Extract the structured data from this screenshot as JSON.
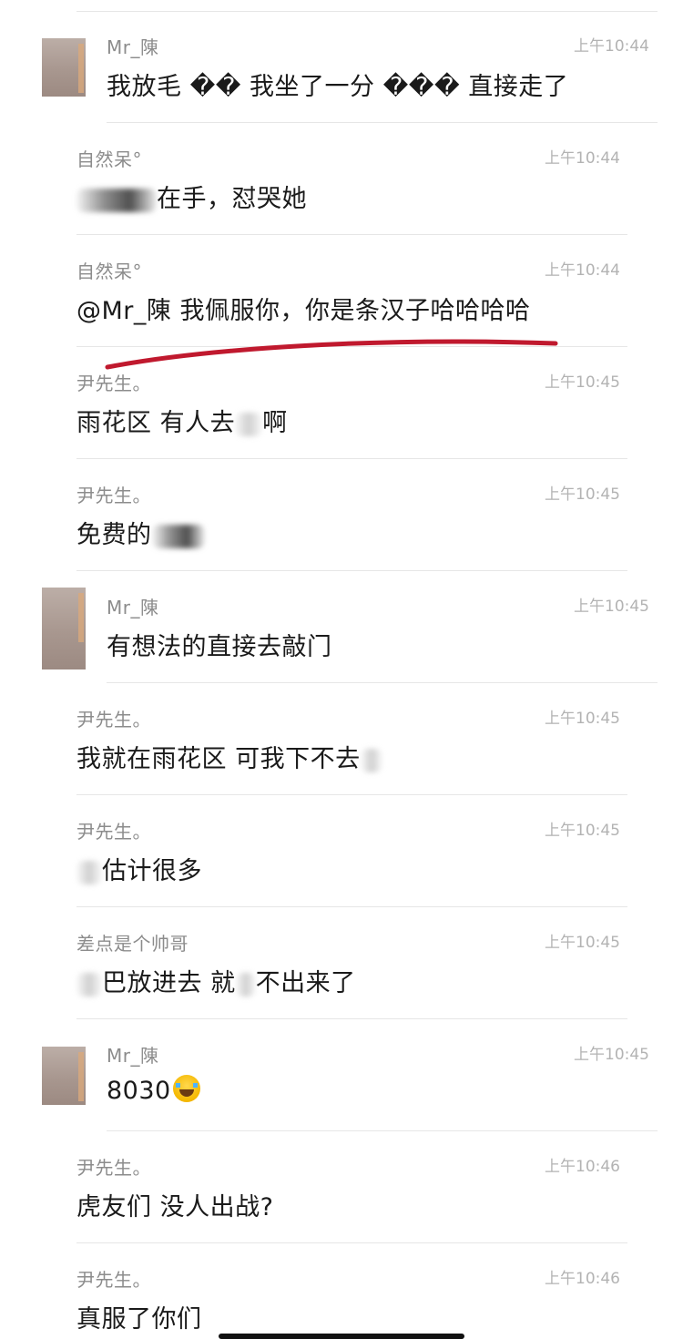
{
  "messages": [
    {
      "sender": "Mr_陳",
      "time": "上午10:44",
      "has_avatar": true,
      "text": "我放毛 �� 我坐了一分 ��� 直接走了"
    },
    {
      "sender": "自然呆°",
      "time": "上午10:44",
      "has_avatar": false,
      "text_before": "",
      "text_after": "在手，怼哭她"
    },
    {
      "sender": "自然呆°",
      "time": "上午10:44",
      "has_avatar": false,
      "text": "@Mr_陳 我佩服你，你是条汉子哈哈哈哈"
    },
    {
      "sender": "尹先生。",
      "time": "上午10:45",
      "has_avatar": false,
      "text_before": "雨花区 有人去",
      "text_after": "啊"
    },
    {
      "sender": "尹先生。",
      "time": "上午10:45",
      "has_avatar": false,
      "text_before": "免费的",
      "text_after": ""
    },
    {
      "sender": "Mr_陳",
      "time": "上午10:45",
      "has_avatar": true,
      "text": "有想法的直接去敲门"
    },
    {
      "sender": "尹先生。",
      "time": "上午10:45",
      "has_avatar": false,
      "text_before": "我就在雨花区 可我下不去",
      "text_after": ""
    },
    {
      "sender": "尹先生。",
      "time": "上午10:45",
      "has_avatar": false,
      "text_before": "",
      "text_after": "估计很多"
    },
    {
      "sender": "差点是个帅哥",
      "time": "上午10:45",
      "has_avatar": false,
      "text_before": "",
      "text_mid": "巴放进去 就",
      "text_after": "不出来了"
    },
    {
      "sender": "Mr_陳",
      "time": "上午10:45",
      "has_avatar": true,
      "text": "8030"
    },
    {
      "sender": "尹先生。",
      "time": "上午10:46",
      "has_avatar": false,
      "text": "虎友们 没人出战?"
    },
    {
      "sender": "尹先生。",
      "time": "上午10:46",
      "has_avatar": false,
      "text": "真服了你们"
    }
  ],
  "icons": {
    "laugh_emoji": "face-with-tears-of-joy-icon"
  },
  "colors": {
    "annotation": "#c0192e",
    "name": "#8c8c8c",
    "time": "#b3b3b3",
    "text": "#1a1a1a",
    "divider": "#e6e6e6"
  }
}
